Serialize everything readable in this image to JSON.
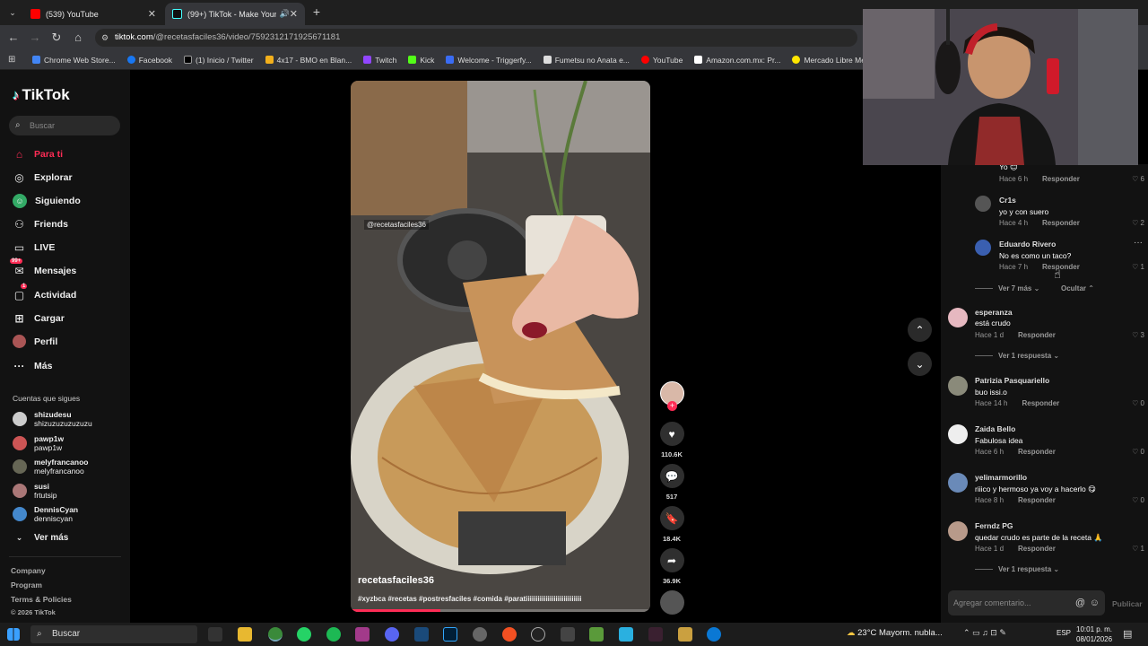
{
  "browser": {
    "tabs": [
      {
        "title": "(539) YouTube",
        "active": false
      },
      {
        "title": "(99+) TikTok - Make Your Da",
        "active": true
      }
    ],
    "url_host": "tiktok.com",
    "url_path": "/@recetasfaciles36/video/7592312171925671181",
    "bookmarks": [
      "Chrome Web Store...",
      "Facebook",
      "(1) Inicio / Twitter",
      "4x17 - BMO en Blan...",
      "Twitch",
      "Kick",
      "Welcome - Triggerfy...",
      "Fumetsu no Anata e...",
      "YouTube",
      "Amazon.com.mx: Pr...",
      "Mercado Libre Méxi..."
    ]
  },
  "sidebar": {
    "logo": "TikTok",
    "search_placeholder": "Buscar",
    "nav": [
      {
        "label": "Para ti",
        "icon": "home-icon"
      },
      {
        "label": "Explorar",
        "icon": "compass-icon"
      },
      {
        "label": "Siguiendo",
        "icon": "following-icon"
      },
      {
        "label": "Friends",
        "icon": "friends-icon"
      },
      {
        "label": "LIVE",
        "icon": "live-icon"
      },
      {
        "label": "Mensajes",
        "icon": "messages-icon",
        "badge": "99+"
      },
      {
        "label": "Actividad",
        "icon": "activity-icon",
        "badge": "1"
      },
      {
        "label": "Cargar",
        "icon": "upload-icon"
      },
      {
        "label": "Perfil",
        "icon": "profile-icon"
      },
      {
        "label": "Más",
        "icon": "more-icon"
      }
    ],
    "following_title": "Cuentas que sigues",
    "following": [
      {
        "user": "shizudesu",
        "name": "shizuzuzuzuzuzu"
      },
      {
        "user": "pawp1w",
        "name": "pawp1w"
      },
      {
        "user": "melyfrancanoo",
        "name": "melyfrancanoo"
      },
      {
        "user": "susi",
        "name": "frtutsip"
      },
      {
        "user": "DennisCyan",
        "name": "denniscyan"
      }
    ],
    "see_more": "Ver más",
    "footer": [
      "Company",
      "Program",
      "Terms & Policies",
      "© 2026 TikTok"
    ]
  },
  "video": {
    "watermark": "@recetasfaciles36",
    "author": "recetasfaciles36",
    "caption": "#xyzbca #recetas #postresfaciles #comida #paratiiiiiiiiiiiiiiiiiiiiiiiiiiii",
    "progress": 0.3,
    "likes": "110.6K",
    "comments": "517",
    "saves": "18.4K",
    "shares": "36.9K"
  },
  "comments": {
    "items": [
      {
        "user": "",
        "text": "Yo 😊",
        "time": "Hace 6 h",
        "reply": "Responder",
        "likes": "6"
      },
      {
        "user": "Cr1s",
        "text": "yo y con suero",
        "time": "Hace 4 h",
        "reply": "Responder",
        "likes": "2"
      },
      {
        "user": "Eduardo Rivero",
        "text": "No es como un taco?",
        "time": "Hace 7 h",
        "reply": "Responder",
        "likes": "1"
      },
      {
        "user": "esperanza",
        "text": "está crudo",
        "time": "Hace 1 d",
        "reply": "Responder",
        "likes": "3"
      },
      {
        "user": "Patrizia Pasquariello",
        "text": "buo issi.o",
        "time": "Hace 14 h",
        "reply": "Responder",
        "likes": "0"
      },
      {
        "user": "Zaida Bello",
        "text": "Fabulosa idea",
        "time": "Hace 6 h",
        "reply": "Responder",
        "likes": "0"
      },
      {
        "user": "yelimarmorillo",
        "text": "riiico y hermoso ya voy a hacerlo 😋",
        "time": "Hace 8 h",
        "reply": "Responder",
        "likes": "0"
      },
      {
        "user": "Ferndz PG",
        "text": "quedar crudo es parte de la receta 🙏",
        "time": "Hace 1 d",
        "reply": "Responder",
        "likes": "1"
      }
    ],
    "see_more_7": "Ver 7 más",
    "hide": "Ocultar",
    "see_one_reply": "Ver 1 respuesta",
    "input_placeholder": "Agregar comentario...",
    "publish": "Publicar"
  },
  "taskbar": {
    "search": "Buscar",
    "weather": "23°C  Mayorm. nubla...",
    "lang": "ESP",
    "time": "10:01 p. m.",
    "date": "08/01/2026"
  },
  "colors": {
    "accent": "#fe2c55",
    "sidebar_bg": "#121212",
    "chrome_bg": "#35363a"
  }
}
